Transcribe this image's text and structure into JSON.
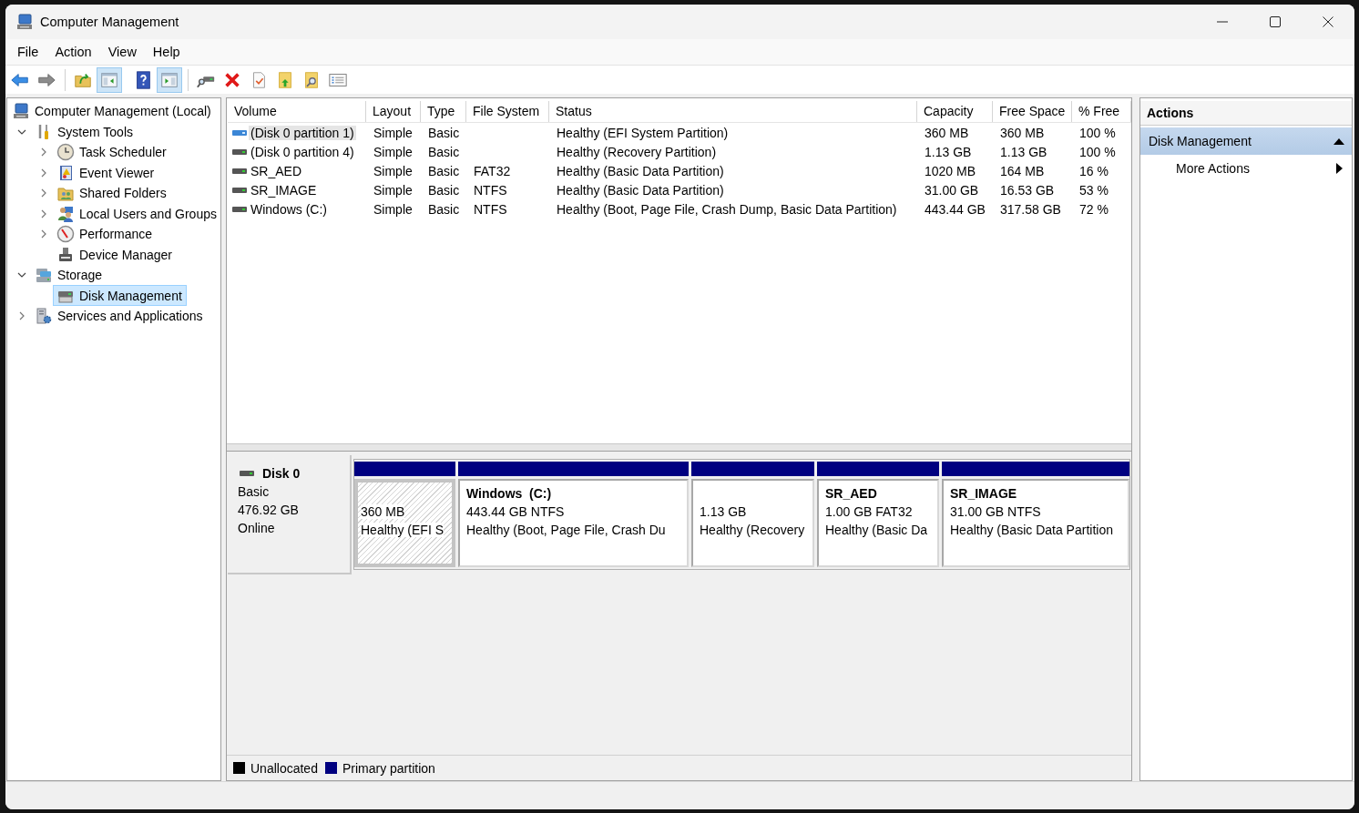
{
  "window": {
    "title": "Computer Management"
  },
  "menu": [
    {
      "label": "File"
    },
    {
      "label": "Action"
    },
    {
      "label": "View"
    },
    {
      "label": "Help"
    }
  ],
  "toolbar": [
    [
      {
        "pressed": false
      },
      {
        "pressed": false
      }
    ],
    [
      {
        "pressed": false
      },
      {
        "pressed": true
      }
    ],
    [
      {
        "pressed": false
      },
      {
        "pressed": true
      }
    ],
    [
      {
        "pressed": false
      },
      {
        "pressed": false
      },
      {
        "pressed": false
      },
      {
        "pressed": false
      },
      {
        "pressed": false
      },
      {
        "pressed": false
      }
    ]
  ],
  "tree": [
    {
      "label": "Computer Management (Local)",
      "selected": false,
      "children": [
        {
          "label": "System Tools",
          "expanded": true,
          "selected": false,
          "children": [
            {
              "label": "Task Scheduler",
              "expanded": false,
              "selected": false
            },
            {
              "label": "Event Viewer",
              "expanded": false,
              "selected": false
            },
            {
              "label": "Shared Folders",
              "expanded": false,
              "selected": false
            },
            {
              "label": "Local Users and Groups",
              "expanded": false,
              "selected": false
            },
            {
              "label": "Performance",
              "expanded": false,
              "selected": false
            },
            {
              "label": "Device Manager",
              "selected": false
            }
          ]
        },
        {
          "label": "Storage",
          "expanded": true,
          "selected": false,
          "children": [
            {
              "label": "Disk Management",
              "selected": true
            }
          ]
        },
        {
          "label": "Services and Applications",
          "expanded": false,
          "selected": false
        }
      ]
    }
  ],
  "volume_list": {
    "columns": [
      "Volume",
      "Layout",
      "Type",
      "File System",
      "Status",
      "Capacity",
      "Free Space",
      "% Free"
    ],
    "rows": [
      {
        "volume": "(Disk 0 partition 1)",
        "layout": "Simple",
        "type": "Basic",
        "status": "Healthy (EFI System Partition)",
        "capacity": "360 MB",
        "free_space": "360 MB",
        "percent_free": "100 %",
        "selected": true
      },
      {
        "volume": "(Disk 0 partition 4)",
        "layout": "Simple",
        "type": "Basic",
        "status": "Healthy (Recovery Partition)",
        "capacity": "1.13 GB",
        "free_space": "1.13 GB",
        "percent_free": "100 %",
        "selected": false
      },
      {
        "volume": "SR_AED",
        "layout": "Simple",
        "type": "Basic",
        "file_system": "FAT32",
        "status": "Healthy (Basic Data Partition)",
        "capacity": "1020 MB",
        "free_space": "164 MB",
        "percent_free": "16 %",
        "selected": false
      },
      {
        "volume": "SR_IMAGE",
        "layout": "Simple",
        "type": "Basic",
        "file_system": "NTFS",
        "status": "Healthy (Basic Data Partition)",
        "capacity": "31.00 GB",
        "free_space": "16.53 GB",
        "percent_free": "53 %",
        "selected": false
      },
      {
        "volume": "Windows (C:)",
        "layout": "Simple",
        "type": "Basic",
        "file_system": "NTFS",
        "status": "Healthy (Boot, Page File, Crash Dump, Basic Data Partition)",
        "capacity": "443.44 GB",
        "free_space": "317.58 GB",
        "percent_free": "72 %",
        "selected": false
      }
    ]
  },
  "disks": [
    {
      "name": "Disk 0",
      "type": "Basic",
      "size": "476.92 GB",
      "status": "Online",
      "partitions": [
        {
          "size": "360 MB",
          "status": "Healthy (EFI S",
          "kind": "primary",
          "selected": true
        },
        {
          "name": "Windows  (C:)",
          "size": "443.44 GB NTFS",
          "status": "Healthy (Boot, Page File, Crash Du",
          "kind": "primary",
          "selected": false
        },
        {
          "size": "1.13 GB",
          "status": "Healthy (Recovery",
          "kind": "primary",
          "selected": false
        },
        {
          "name": "SR_AED",
          "size": "1.00 GB FAT32",
          "status": "Healthy (Basic Da",
          "kind": "primary",
          "selected": false
        },
        {
          "name": "SR_IMAGE",
          "size": "31.00 GB NTFS",
          "status": "Healthy (Basic Data Partition",
          "kind": "primary",
          "selected": false
        }
      ]
    }
  ],
  "legend": [
    {
      "label": "Unallocated",
      "color": "#000000"
    },
    {
      "label": "Primary partition",
      "color": "#000080"
    }
  ],
  "actions": {
    "title": "Actions",
    "sections": [
      {
        "label": "Disk Management",
        "expanded": true,
        "items": [
          {
            "label": "More Actions"
          }
        ]
      }
    ]
  }
}
